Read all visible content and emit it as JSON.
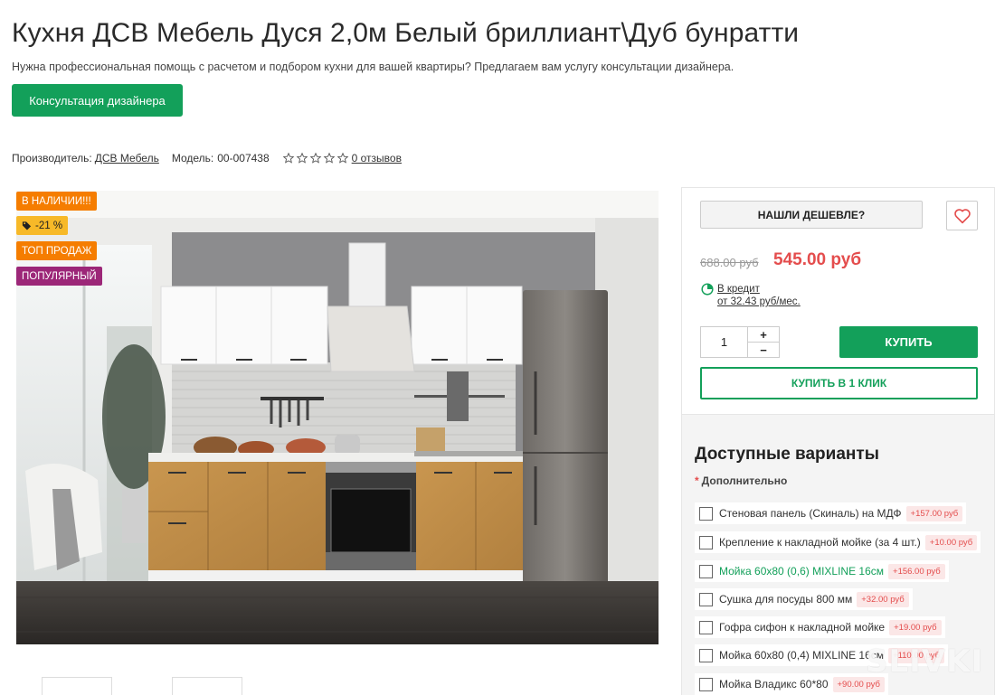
{
  "header": {
    "title": "Кухня ДСВ Мебель Дуся 2,0м Белый бриллиант\\Дуб бунратти",
    "subtitle": "Нужна профессиональная помощь с расчетом и подбором кухни для вашей квартиры? Предлагаем вам услугу консультации дизайнера.",
    "consult_label": "Консультация дизайнера"
  },
  "meta": {
    "manufacturer_label": "Производитель:",
    "manufacturer": "ДСВ Мебель",
    "model_label": "Модель:",
    "model": "00-007438",
    "rating": 0,
    "reviews": "0 отзывов"
  },
  "badges": {
    "stock": "В НАЛИЧИИ!!!",
    "sale": "-21 %",
    "top": "ТОП ПРОДАЖ",
    "popular": "ПОПУЛЯРНЫЙ"
  },
  "purchase": {
    "cheaper_label": "НАШЛИ ДЕШЕВЛЕ?",
    "old_price": "688.00 руб",
    "new_price": "545.00 руб",
    "credit_label": "В кредит",
    "credit_amount": "от 32.43 руб/мес.",
    "quantity": "1",
    "plus": "+",
    "minus": "−",
    "buy_label": "КУПИТЬ",
    "oneclick_label": "КУПИТЬ В 1 КЛИК"
  },
  "variants": {
    "title": "Доступные варианты",
    "required_label": "Дополнительно",
    "options": [
      {
        "label": "Стеновая панель (Скиналь) на МДФ",
        "price": "+157.00 руб"
      },
      {
        "label": "Крепление к накладной мойке (за 4 шт.)",
        "price": "+10.00 руб"
      },
      {
        "label": "Мойка 60х80 (0,6) MIXLINE 16см",
        "price": "+156.00 руб"
      },
      {
        "label": "Сушка для посуды 800 мм",
        "price": "+32.00 руб"
      },
      {
        "label": "Гофра сифон к накладной мойке",
        "price": "+19.00 руб"
      },
      {
        "label": "Мойка 60х80 (0,4) MIXLINE 16см",
        "price": "+110.00 руб"
      },
      {
        "label": "Мойка Владикс 60*80",
        "price": "+90.00 руб"
      }
    ]
  },
  "watermark": "SLIVKI",
  "colors": {
    "accent_green": "#13a05a",
    "price_red": "#e44d4d",
    "badge_orange": "#f57d00",
    "badge_yellow": "#f7b928",
    "badge_purple": "#9c2778"
  }
}
